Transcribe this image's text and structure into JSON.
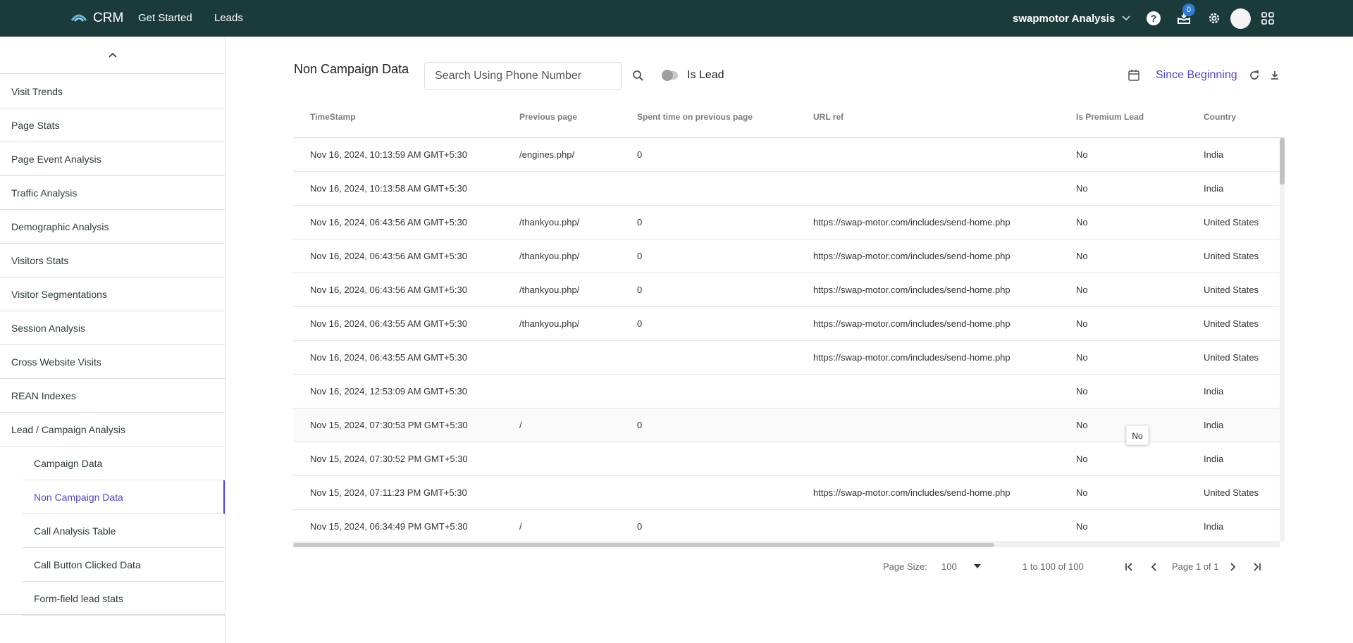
{
  "topbar": {
    "app_name": "CRM",
    "nav": [
      "Get Started",
      "Leads"
    ],
    "account": "swapmotor Analysis",
    "notifications_count": "0"
  },
  "sidebar": {
    "items": [
      "Visit Trends",
      "Page Stats",
      "Page Event Analysis",
      "Traffic Analysis",
      "Demographic Analysis",
      "Visitors Stats",
      "Visitor Segmentations",
      "Session Analysis",
      "Cross Website Visits",
      "REAN Indexes",
      "Lead / Campaign Analysis"
    ],
    "sub_items": [
      "Campaign Data",
      "Non Campaign Data",
      "Call Analysis Table",
      "Call Button Clicked Data",
      "Form-field lead stats"
    ],
    "active": "Non Campaign Data"
  },
  "main": {
    "title": "Non Campaign Data",
    "search_placeholder": "Search Using Phone Number",
    "toggle_label": "Is Lead",
    "toggle_on": false,
    "date_range": "Since Beginning"
  },
  "table": {
    "columns": [
      "TimeStamp",
      "Previous page",
      "Spent time on previous page",
      "URL ref",
      "Is Premium Lead",
      "Country"
    ],
    "rows": [
      [
        "Nov 16, 2024, 10:13:59 AM GMT+5:30",
        "/engines.php/",
        "0",
        "",
        "No",
        "India"
      ],
      [
        "Nov 16, 2024, 10:13:58 AM GMT+5:30",
        "",
        "",
        "",
        "No",
        "India"
      ],
      [
        "Nov 16, 2024, 06:43:56 AM GMT+5:30",
        "/thankyou.php/",
        "0",
        "https://swap-motor.com/includes/send-home.php",
        "No",
        "United States"
      ],
      [
        "Nov 16, 2024, 06:43:56 AM GMT+5:30",
        "/thankyou.php/",
        "0",
        "https://swap-motor.com/includes/send-home.php",
        "No",
        "United States"
      ],
      [
        "Nov 16, 2024, 06:43:56 AM GMT+5:30",
        "/thankyou.php/",
        "0",
        "https://swap-motor.com/includes/send-home.php",
        "No",
        "United States"
      ],
      [
        "Nov 16, 2024, 06:43:55 AM GMT+5:30",
        "/thankyou.php/",
        "0",
        "https://swap-motor.com/includes/send-home.php",
        "No",
        "United States"
      ],
      [
        "Nov 16, 2024, 06:43:55 AM GMT+5:30",
        "",
        "",
        "https://swap-motor.com/includes/send-home.php",
        "No",
        "United States"
      ],
      [
        "Nov 16, 2024, 12:53:09 AM GMT+5:30",
        "",
        "",
        "",
        "No",
        "India"
      ],
      [
        "Nov 15, 2024, 07:30:53 PM GMT+5:30",
        "/",
        "0",
        "",
        "No",
        "India"
      ],
      [
        "Nov 15, 2024, 07:30:52 PM GMT+5:30",
        "",
        "",
        "",
        "No",
        "India"
      ],
      [
        "Nov 15, 2024, 07:11:23 PM GMT+5:30",
        "",
        "",
        "https://swap-motor.com/includes/send-home.php",
        "No",
        "United States"
      ],
      [
        "Nov 15, 2024, 06:34:49 PM GMT+5:30",
        "/",
        "0",
        "",
        "No",
        "India"
      ]
    ],
    "hovered_row": 8,
    "tooltip": "No"
  },
  "pagination": {
    "page_size_label": "Page Size:",
    "page_size": "100",
    "range": "1 to 100 of 100",
    "page_info": "Page 1 of 1"
  },
  "colors": {
    "topbar": "#1b3a3a",
    "accent": "#4f46d6",
    "badge": "#2f7bd6"
  }
}
